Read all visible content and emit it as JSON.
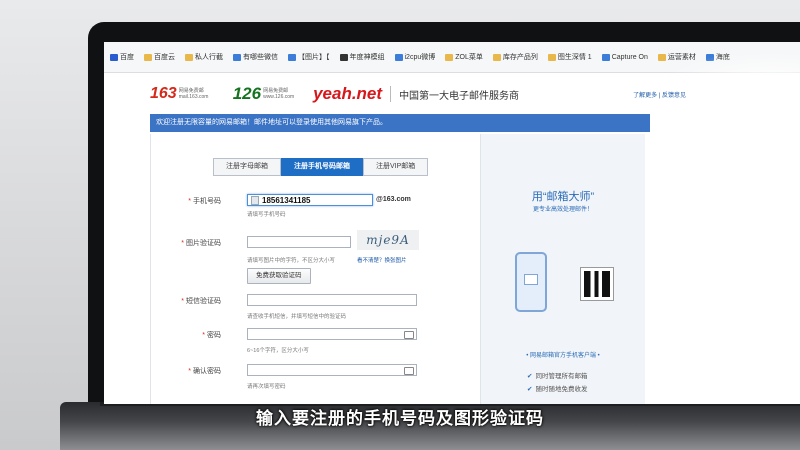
{
  "bookmarks": [
    {
      "label": "百度",
      "icon": "paw-icon"
    },
    {
      "label": "百度云",
      "icon": "folder-icon"
    },
    {
      "label": "私人行截",
      "icon": "folder-icon"
    },
    {
      "label": "有哪些微信",
      "icon": "blue-square-icon"
    },
    {
      "label": "【图片】【",
      "icon": "blue-square-icon"
    },
    {
      "label": "年度神模组",
      "icon": "dark-icon"
    },
    {
      "label": "i2cpu微博",
      "icon": "blue-square-icon"
    },
    {
      "label": "ZOL菜单",
      "icon": "folder-icon"
    },
    {
      "label": "库存产品列",
      "icon": "folder-icon"
    },
    {
      "label": "图生深情 1",
      "icon": "folder-icon"
    },
    {
      "label": "Capture On",
      "icon": "gear-icon"
    },
    {
      "label": "运营素材",
      "icon": "folder-icon"
    },
    {
      "label": "海底",
      "icon": "blue-square-icon"
    }
  ],
  "header": {
    "logo_163": "163",
    "logo_163_sub": "网易免费邮 mail.163.com",
    "logo_126": "126",
    "logo_126_sub": "网易免费邮 www.126.com",
    "logo_yeah": "yeah.net",
    "slogan": "中国第一大电子邮件服务商",
    "links": "了解更多 | 反馈意见"
  },
  "notice": "欢迎注册无限容量的网易邮箱！邮件地址可以登录使用其他网易旗下产品。",
  "tabs": [
    {
      "label": "注册字母邮箱",
      "active": false
    },
    {
      "label": "注册手机号码邮箱",
      "active": true
    },
    {
      "label": "注册VIP邮箱",
      "active": false
    }
  ],
  "form": {
    "phone_label": "手机号码",
    "phone_value": "18561341185",
    "phone_suffix": "@163.com",
    "phone_hint": "请填写手机号码",
    "captcha_label": "图片验证码",
    "captcha_text": "mje9A",
    "captcha_hint": "请填写图片中的字符，不区分大小写",
    "captcha_refresh": "看不清楚？换张图片",
    "sms_button": "免费获取验证码",
    "sms_label": "短信验证码",
    "sms_hint": "请查收手机短信，并填写短信中的验证码",
    "pw_label": "密码",
    "pw_hint": "6~16个字符，区分大小写",
    "pw2_label": "确认密码",
    "pw2_hint": "请再次填写密码"
  },
  "promo": {
    "title": "用“邮箱大师”",
    "subtitle": "更专业高效处理邮件！",
    "link": "• 网易邮箱官方手机客户端 •",
    "features": [
      "同时管理所有邮箱",
      "随时随地免费收发"
    ]
  },
  "caption": "输入要注册的手机号码及图形验证码"
}
